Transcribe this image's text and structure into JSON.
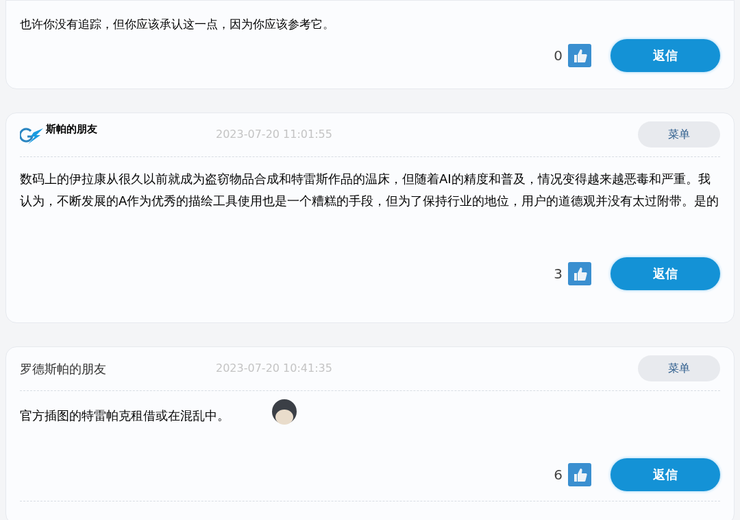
{
  "comments": [
    {
      "kind": "partial",
      "body": "也许你没有追踪，但你应该承认这一点，因为你应该参考它。",
      "likes": "0",
      "reply": "返信"
    },
    {
      "kind": "logo",
      "author": "斯帕的朋友",
      "time": "2023-07-20 11:01:55",
      "menu": "菜单",
      "body": "数码上的伊拉康从很久以前就成为盗窃物品合成和特雷斯作品的温床，但随着AI的精度和普及，情况变得越来越恶毒和严重。我认为，不断发展的A作为优秀的描绘工具使用也是一个糟糕的手段，但为了保持行业的地位，用户的道德观并没有太过附带。是的",
      "likes": "3",
      "reply": "返信"
    },
    {
      "kind": "sticker",
      "author": "罗德斯帕的朋友",
      "time": "2023-07-20 10:41:35",
      "menu": "菜单",
      "body": "官方插图的特雷帕克租借或在混乱中。",
      "likes": "6",
      "reply": "返信"
    }
  ]
}
